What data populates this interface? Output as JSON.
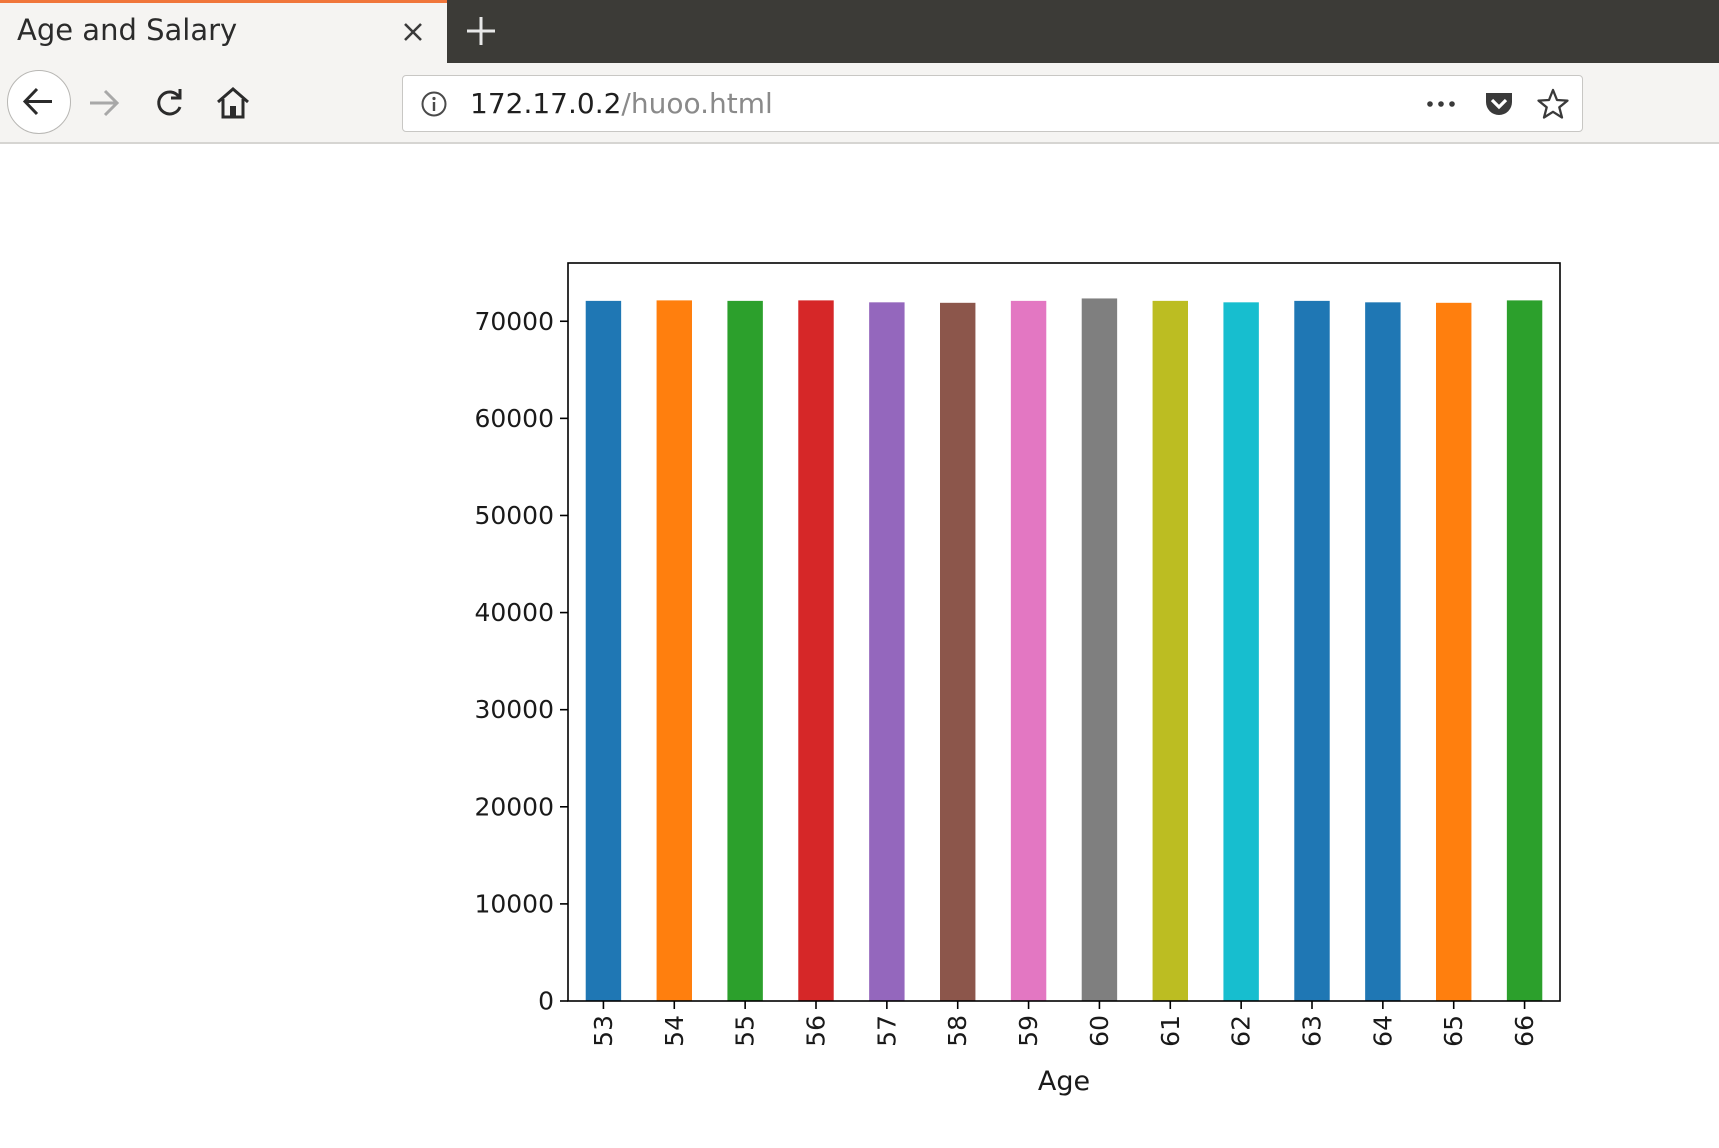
{
  "browser": {
    "tab_title": "Age and Salary",
    "url_host": "172.17.0.2",
    "url_path": "/huoo.html",
    "tab_accent_color": "#f0763b",
    "icons": {
      "close": "close-icon",
      "new_tab": "plus-icon",
      "back": "back-arrow-icon",
      "forward": "forward-arrow-icon",
      "reload": "reload-icon",
      "home": "home-icon",
      "info": "info-icon",
      "page_actions": "ellipsis-icon",
      "pocket": "pocket-icon",
      "bookmark": "star-icon"
    }
  },
  "chart_data": {
    "type": "bar",
    "title": "",
    "xlabel": "Age",
    "ylabel": "",
    "categories": [
      "53",
      "54",
      "55",
      "56",
      "57",
      "58",
      "59",
      "60",
      "61",
      "62",
      "63",
      "64",
      "65",
      "66"
    ],
    "values": [
      72100,
      72150,
      72100,
      72150,
      71950,
      71900,
      72100,
      72350,
      72100,
      71950,
      72100,
      71950,
      71900,
      72150
    ],
    "ylim": [
      0,
      76000
    ],
    "yticks": [
      0,
      10000,
      20000,
      30000,
      40000,
      50000,
      60000,
      70000
    ],
    "grid": false,
    "legend": "none",
    "bar_colors": [
      "#1f77b4",
      "#ff7f0e",
      "#2ca02c",
      "#d62728",
      "#9467bd",
      "#8c564b",
      "#e377c2",
      "#7f7f7f",
      "#bcbd22",
      "#17becf",
      "#1f77b4",
      "#1f77b4",
      "#ff7f0e",
      "#2ca02c"
    ]
  }
}
